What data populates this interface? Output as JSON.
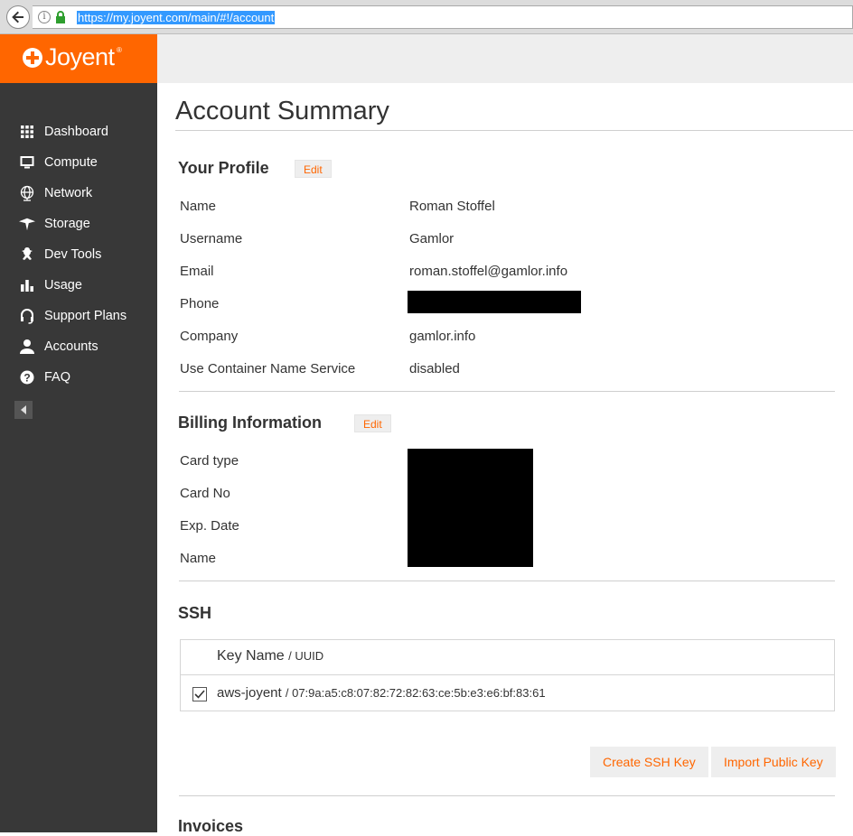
{
  "browser": {
    "url": "https://my.joyent.com/main/#!/account"
  },
  "sidebar": {
    "logo_text": "Joyent",
    "items": [
      {
        "label": "Dashboard",
        "icon": "grid-icon"
      },
      {
        "label": "Compute",
        "icon": "monitor-icon"
      },
      {
        "label": "Network",
        "icon": "globe-icon"
      },
      {
        "label": "Storage",
        "icon": "manta-icon"
      },
      {
        "label": "Dev Tools",
        "icon": "dev-tools-icon"
      },
      {
        "label": "Usage",
        "icon": "bar-chart-icon"
      },
      {
        "label": "Support Plans",
        "icon": "headset-icon"
      },
      {
        "label": "Accounts",
        "icon": "user-icon"
      },
      {
        "label": "FAQ",
        "icon": "question-icon"
      }
    ]
  },
  "main": {
    "page_title": "Account Summary",
    "profile": {
      "title": "Your Profile",
      "edit_label": "Edit",
      "rows": [
        {
          "label": "Name",
          "value": "Roman Stoffel"
        },
        {
          "label": "Username",
          "value": "Gamlor"
        },
        {
          "label": "Email",
          "value": "roman.stoffel@gamlor.info"
        },
        {
          "label": "Phone",
          "value": ""
        },
        {
          "label": "Company",
          "value": "gamlor.info"
        },
        {
          "label": "Use Container Name Service",
          "value": "disabled"
        }
      ]
    },
    "billing": {
      "title": "Billing Information",
      "edit_label": "Edit",
      "rows": [
        {
          "label": "Card type"
        },
        {
          "label": "Card No"
        },
        {
          "label": "Exp. Date"
        },
        {
          "label": "Name"
        }
      ]
    },
    "ssh": {
      "title": "SSH",
      "header_key_name": "Key Name",
      "header_uuid": "/ UUID",
      "keys": [
        {
          "name": "aws-joyent",
          "fingerprint": "/ 07:9a:a5:c8:07:82:72:82:63:ce:5b:e3:e6:bf:83:61",
          "checked": true
        }
      ],
      "create_button": "Create SSH Key",
      "import_button": "Import Public Key"
    },
    "invoices": {
      "title": "Invoices"
    }
  }
}
